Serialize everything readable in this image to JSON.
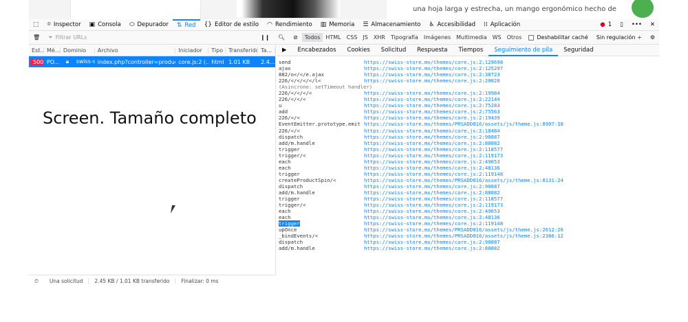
{
  "page": {
    "snippet": "una hoja larga y estrecha, un mango ergonómico hecho de"
  },
  "toolbar": {
    "tabs": [
      {
        "label": "Inspector",
        "icon": "inspector-icon"
      },
      {
        "label": "Consola",
        "icon": "console-icon"
      },
      {
        "label": "Depurador",
        "icon": "debugger-icon"
      },
      {
        "label": "Red",
        "icon": "network-icon"
      },
      {
        "label": "Editor de estilo",
        "icon": "braces-icon"
      },
      {
        "label": "Rendimiento",
        "icon": "gauge-icon"
      },
      {
        "label": "Memoria",
        "icon": "memory-icon"
      },
      {
        "label": "Almacenamiento",
        "icon": "storage-icon"
      },
      {
        "label": "Accesibilidad",
        "icon": "accessibility-icon"
      },
      {
        "label": "Aplicación",
        "icon": "grid-icon"
      }
    ],
    "error_count": "1"
  },
  "filter": {
    "placeholder": "Filtrar URLs",
    "types": [
      "Todos",
      "HTML",
      "CSS",
      "JS",
      "XHR",
      "Tipografía",
      "Imágenes",
      "Multimedia",
      "WS",
      "Otros"
    ],
    "disable_cache": "Deshabilitar caché",
    "throttle": "Sin regulación ÷"
  },
  "table": {
    "headers": [
      "Est...",
      "Mé...",
      "Dominio",
      "Archivo",
      "Iniciador",
      "Tipo",
      "Transferido",
      "Ta..."
    ],
    "row": {
      "status": "500",
      "method": "PO...",
      "domain": "swiss-s...",
      "file": "index.php?controller=produc",
      "initiator": "core.js:2 (...",
      "type": "html",
      "transferred": "1.01 KB",
      "size": "2.4..."
    }
  },
  "details": {
    "tabs": [
      "Encabezados",
      "Cookies",
      "Solicitud",
      "Respuesta",
      "Tiempos",
      "Seguimiento de pila",
      "Seguridad"
    ],
    "stack": [
      {
        "fn": "send",
        "url": "https://swiss-store.mx/themes/core.js:2:129698"
      },
      {
        "fn": "ajax",
        "url": "https://swiss-store.mx/themes/core.js:2:125297"
      },
      {
        "fn": "882/o</</e.ajax",
        "url": "https://swiss-store.mx/themes/core.js:2:38723"
      },
      {
        "fn": "226/</</</</l<",
        "url": "https://swiss-store.mx/themes/core.js:2:20028"
      },
      {
        "fn": "(Asincrono: setTimeout handler)",
        "url": ""
      },
      {
        "fn": "226/</</</<",
        "url": "https://swiss-store.mx/themes/core.js:2:19984"
      },
      {
        "fn": "226/</</<",
        "url": "https://swiss-store.mx/themes/core.js:2:22144"
      },
      {
        "fn": "u",
        "url": "https://swiss-store.mx/themes/core.js:2:75283"
      },
      {
        "fn": "add",
        "url": "https://swiss-store.mx/themes/core.js:2:75563"
      },
      {
        "fn": "226/</<",
        "url": "https://swiss-store.mx/themes/core.js:2:19439"
      },
      {
        "fn": "EventEmitter.prototype.emit",
        "url": "https://swiss-store.mx/themes/PRSADD016/assets/js/theme.js:8907:18"
      },
      {
        "fn": "226/</<",
        "url": "https://swiss-store.mx/themes/core.js:2:18484"
      },
      {
        "fn": "dispatch",
        "url": "https://swiss-store.mx/themes/core.js:2:90087"
      },
      {
        "fn": "add/m.handle",
        "url": "https://swiss-store.mx/themes/core.js:2:88082"
      },
      {
        "fn": "trigger",
        "url": "https://swiss-store.mx/themes/core.js:2:118577"
      },
      {
        "fn": "trigger/<",
        "url": "https://swiss-store.mx/themes/core.js:2:119173"
      },
      {
        "fn": "each",
        "url": "https://swiss-store.mx/themes/core.js:2:49653"
      },
      {
        "fn": "each",
        "url": "https://swiss-store.mx/themes/core.js:2:48136"
      },
      {
        "fn": "trigger",
        "url": "https://swiss-store.mx/themes/core.js:2:119148"
      },
      {
        "fn": "createProductSpin/<",
        "url": "https://swiss-store.mx/themes/PRSADD016/assets/js/theme.js:8131:24"
      },
      {
        "fn": "dispatch",
        "url": "https://swiss-store.mx/themes/core.js:2:90087"
      },
      {
        "fn": "add/m.handle",
        "url": "https://swiss-store.mx/themes/core.js:2:88082"
      },
      {
        "fn": "trigger",
        "url": "https://swiss-store.mx/themes/core.js:2:118577"
      },
      {
        "fn": "trigger/<",
        "url": "https://swiss-store.mx/themes/core.js:2:119173"
      },
      {
        "fn": "each",
        "url": "https://swiss-store.mx/themes/core.js:2:49653"
      },
      {
        "fn": "each",
        "url": "https://swiss-store.mx/themes/core.js:2:48136"
      },
      {
        "fn": "trigger",
        "url": "https://swiss-store.mx/themes/core.js:2:119148",
        "selected": true
      },
      {
        "fn": "upOnce",
        "url": "https://swiss-store.mx/themes/PRSADD016/assets/js/theme.js:2612:26"
      },
      {
        "fn": "_bindEvents/<",
        "url": "https://swiss-store.mx/themes/PRSADD016/assets/js/theme.js:2386:12"
      },
      {
        "fn": "dispatch",
        "url": "https://swiss-store.mx/themes/core.js:2:90087"
      },
      {
        "fn": "add/m.handle",
        "url": "https://swiss-store.mx/themes/core.js:2:88082"
      }
    ]
  },
  "status": {
    "requests": "Una solicitud",
    "transferred": "2.45 KB / 1.01 KB transferido",
    "finish": "Finalizar: 0 ms"
  },
  "caption": "Screen. Tamaño completo"
}
